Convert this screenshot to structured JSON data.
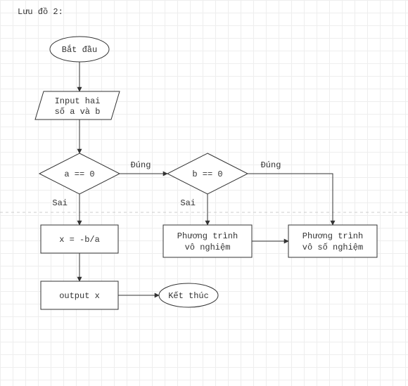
{
  "title": "Lưu đồ 2:",
  "nodes": {
    "start": "Bắt đầu",
    "input_line1": "Input hai",
    "input_line2": "số a và b",
    "dec_a": "a == 0",
    "dec_b": "b == 0",
    "calc": "x = -b/a",
    "output": "output x",
    "vo_nghiem_line1": "Phương trình",
    "vo_nghiem_line2": "vô nghiệm",
    "vo_so_nghiem_line1": "Phương trình",
    "vo_so_nghiem_line2": "vô số nghiệm",
    "end": "Kết thúc"
  },
  "labels": {
    "true_a": "Đúng",
    "false_a": "Sai",
    "true_b": "Đúng",
    "false_b": "Sai"
  }
}
